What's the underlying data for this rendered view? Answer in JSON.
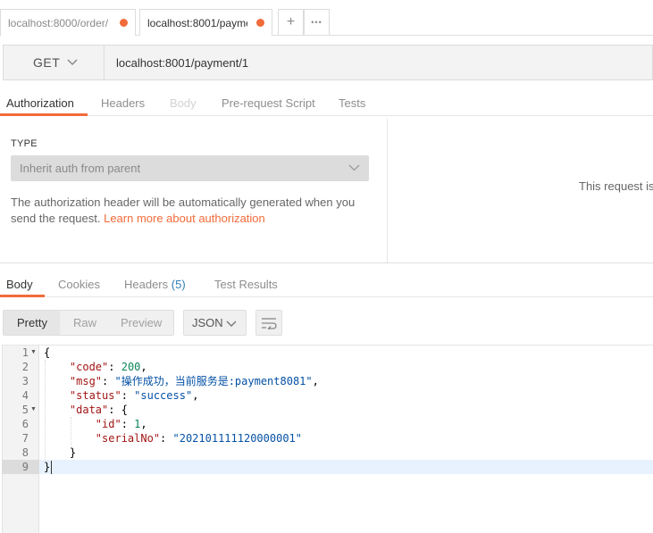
{
  "tabs": [
    {
      "label": "localhost:8000/order/",
      "active": false,
      "unsaved": true
    },
    {
      "label": "localhost:8001/payme",
      "active": true,
      "unsaved": true
    }
  ],
  "tab_actions": {
    "new_tab": "+",
    "more": "•••"
  },
  "request": {
    "method": "GET",
    "url": "localhost:8001/payment/1"
  },
  "request_tabs": [
    {
      "label": "Authorization",
      "state": "active"
    },
    {
      "label": "Headers",
      "state": "normal"
    },
    {
      "label": "Body",
      "state": "disabled"
    },
    {
      "label": "Pre-request Script",
      "state": "normal"
    },
    {
      "label": "Tests",
      "state": "normal"
    }
  ],
  "auth": {
    "type_label": "TYPE",
    "type_value": "Inherit auth from parent",
    "description": "The authorization header will be automatically generated when you send the request.",
    "link": "Learn more about authorization",
    "right_note": "This request is"
  },
  "response_tabs": [
    {
      "label": "Body",
      "state": "active"
    },
    {
      "label": "Cookies",
      "state": "normal"
    },
    {
      "label": "Headers",
      "count": "(5)",
      "state": "normal"
    },
    {
      "label": "Test Results",
      "state": "normal"
    }
  ],
  "view_modes": {
    "pretty": "Pretty",
    "raw": "Raw",
    "preview": "Preview",
    "selected": "Pretty"
  },
  "format": "JSON",
  "code_lines": [
    {
      "n": "1",
      "fold": true
    },
    {
      "n": "2",
      "fold": false
    },
    {
      "n": "3",
      "fold": false
    },
    {
      "n": "4",
      "fold": false
    },
    {
      "n": "5",
      "fold": true
    },
    {
      "n": "6",
      "fold": false
    },
    {
      "n": "7",
      "fold": false
    },
    {
      "n": "8",
      "fold": false
    },
    {
      "n": "9",
      "fold": false
    }
  ],
  "code": {
    "open": "{",
    "k_code": "\"code\"",
    "v_code": "200",
    "k_msg": "\"msg\"",
    "v_msg": "\"操作成功，当前服务是:payment8081\"",
    "k_status": "\"status\"",
    "v_status": "\"success\"",
    "k_data": "\"data\"",
    "data_open": "{",
    "k_id": "\"id\"",
    "v_id": "1",
    "k_serial": "\"serialNo\"",
    "v_serial": "\"202101111120000001\"",
    "data_close": "}",
    "close": "}"
  },
  "colors": {
    "accent": "#f26b3a",
    "link": "#2f7fb5"
  }
}
